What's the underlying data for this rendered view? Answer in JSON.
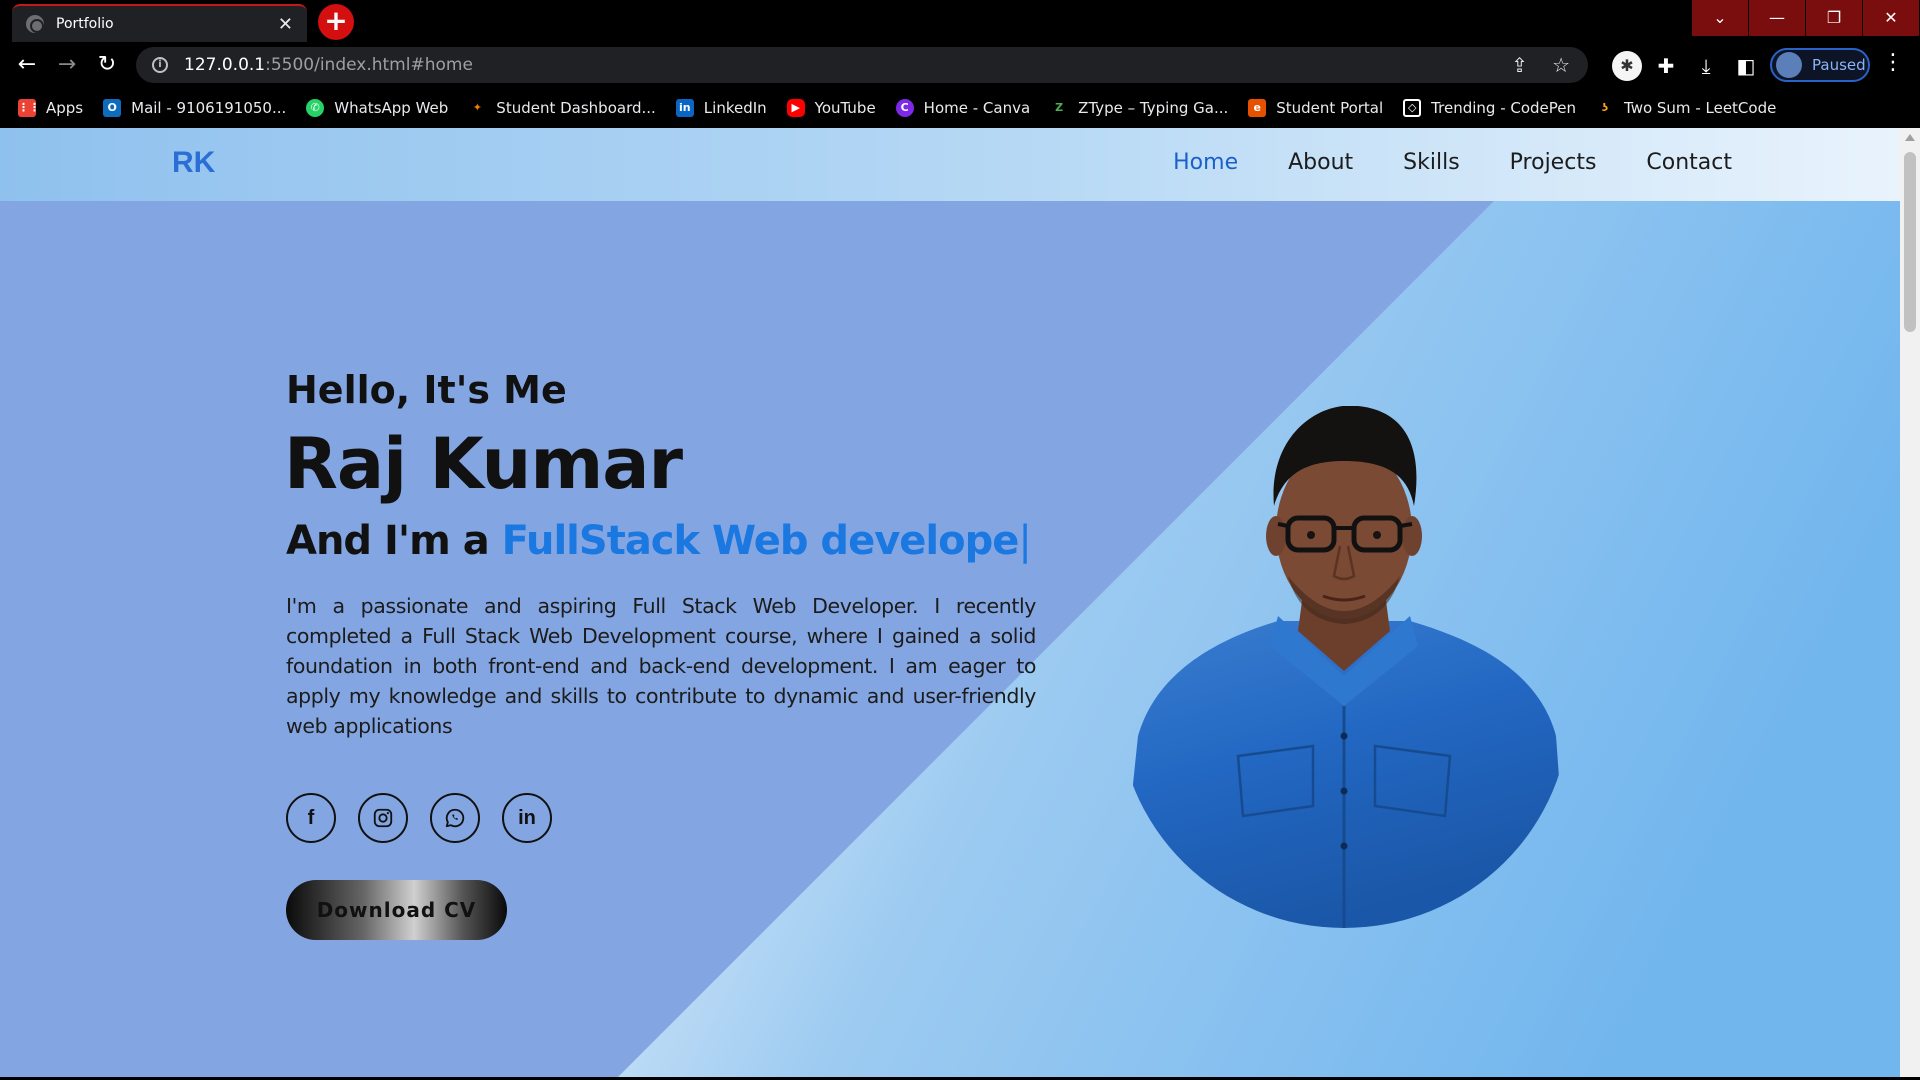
{
  "browser": {
    "tab_title": "Portfolio",
    "url_host": "127.0.0.1",
    "url_path": ":5500/index.html#home",
    "profile_status": "Paused",
    "bookmarks": [
      {
        "label": "Apps",
        "icon": "apps-grid-icon",
        "color": "#ea4335"
      },
      {
        "label": "Mail - 9106191050...",
        "icon": "outlook-icon",
        "color": "#0f6cbd"
      },
      {
        "label": "WhatsApp Web",
        "icon": "whatsapp-icon",
        "color": "#25d366"
      },
      {
        "label": "Student Dashboard...",
        "icon": "student-dashboard-icon",
        "color": "#f57c00"
      },
      {
        "label": "LinkedIn",
        "icon": "linkedin-icon",
        "color": "#0a66c2"
      },
      {
        "label": "YouTube",
        "icon": "youtube-icon",
        "color": "#ff0000"
      },
      {
        "label": "Home - Canva",
        "icon": "canva-icon",
        "color": "#7d2ae8"
      },
      {
        "label": "ZType – Typing Ga...",
        "icon": "ztype-icon",
        "color": "#2e7d32"
      },
      {
        "label": "Student Portal",
        "icon": "student-portal-icon",
        "color": "#e65100"
      },
      {
        "label": "Trending - CodePen",
        "icon": "codepen-icon",
        "color": "#ffffff"
      },
      {
        "label": "Two Sum - LeetCode",
        "icon": "leetcode-icon",
        "color": "#ffa116"
      }
    ]
  },
  "site": {
    "logo": "RK",
    "nav": [
      "Home",
      "About",
      "Skills",
      "Projects",
      "Contact"
    ],
    "active_nav": "Home",
    "hello": "Hello, It's Me",
    "name": "Raj Kumar",
    "role_prefix": "And I'm a ",
    "role_highlight": "FullStack Web develope",
    "role_cursor": "|",
    "bio": "I'm a passionate and aspiring Full Stack Web Developer. I recently completed a Full Stack Web Development course, where I gained a solid foundation in both front-end and back-end development. I am eager to apply my knowledge and skills to contribute to dynamic and user-friendly web applications",
    "socials": [
      "facebook-icon",
      "instagram-icon",
      "whatsapp-icon",
      "linkedin-icon"
    ],
    "linkedin_text": "in",
    "facebook_text": "f",
    "cv_button": "Download CV"
  },
  "colors": {
    "hero_bg": "#83a6e3",
    "accent": "#1a78e0",
    "logo": "#2b6fd6"
  }
}
